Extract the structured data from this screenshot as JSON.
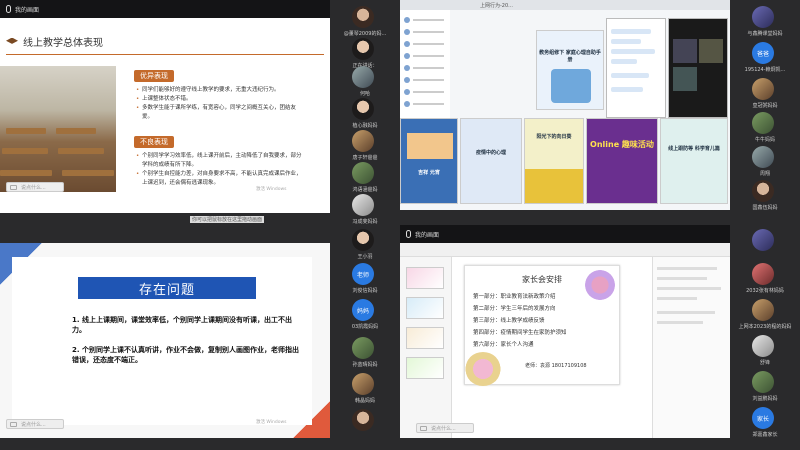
{
  "q1": {
    "top_label": "我的画面",
    "slide_title": "线上教学总体表现",
    "good_label": "优异表现",
    "good_items": [
      "同学们能够好的遵守线上教学的要求，无重大违纪行为。",
      "上课整体状态不错。",
      "多数学生能于课所学练，有宽容心，同学之间概互关心，团结友爱。"
    ],
    "bad_label": "不良表现",
    "bad_items": [
      "个别同学学习效率低，线上课开前后，主动降低了自我要求，部分学科的成绩有所下降。",
      "个别学生自控能力差，对自身要求不高，不能认真完成课后作业，上课迟到，还会偶有逃课现象。"
    ],
    "chat_placeholder": "说点什么...",
    "watermark": "激活 Windows",
    "bottom_overlay": "你可以把鼠标放在这里拖动画面",
    "participants": [
      {
        "name": "@董琴2009的妈...",
        "avatar": "photo1"
      },
      {
        "name": "正在讲话：",
        "avatar": "blue",
        "text": ""
      },
      {
        "name": "何哈",
        "avatar": "photo4"
      },
      {
        "name": "植心融妈妈",
        "avatar": "photo2"
      },
      {
        "name": "唐子轩爸爸",
        "avatar": "photo5"
      },
      {
        "name": "鸿语涵爸妈",
        "avatar": "photo3"
      },
      {
        "name": "冯成斐妈妈",
        "avatar": "photo7"
      }
    ]
  },
  "q2": {
    "top_label": "我的画面",
    "tab_label": "上网行为-20...",
    "poster_texts": [
      "教务组修下 家庭心理自助手册",
      "吉祥 元宵",
      "Online 趣味活动",
      "线上跟防等 科学育儿篇",
      "疫情中的心理",
      "阳光下的向日葵"
    ],
    "participants": [
      {
        "name": "与鑫腾课堂妈妈",
        "avatar": "photo6"
      },
      {
        "name": "195124-赖炯凯...",
        "avatar": "blue",
        "text": "爸爸"
      },
      {
        "name": "皇冠粥妈妈",
        "avatar": "photo5"
      },
      {
        "name": "牛牛妈妈",
        "avatar": "photo3"
      },
      {
        "name": "周翔",
        "avatar": "photo4"
      },
      {
        "name": "国鑫伍妈妈",
        "avatar": "photo1"
      },
      {
        "name": "",
        "avatar": "photo3"
      }
    ]
  },
  "q3": {
    "banner": "存在问题",
    "items": [
      "1. 线上上课期间，课堂效率低，个别同学上课期间没有听课，出工不出力。",
      "2. 个别同学上课不认真听讲，作业不会做，复制别人画图作业，老师指出错误，还态度不端正。"
    ],
    "chat_placeholder": "说点什么...",
    "watermark": "激活 Windows",
    "participants": [
      {
        "name": "王小羽",
        "avatar": "photo2"
      },
      {
        "name": "刘俊信妈妈",
        "avatar": "blue",
        "text": "老师"
      },
      {
        "name": "03凯霞妈妈",
        "avatar": "blue",
        "text": "妈妈"
      },
      {
        "name": "孙蓝晴妈妈",
        "avatar": "photo3"
      },
      {
        "name": "韩晶妈妈",
        "avatar": "photo5"
      },
      {
        "name": "",
        "avatar": "photo1"
      }
    ]
  },
  "q4": {
    "top_label": "我的画面",
    "page_title": "家长会安排",
    "lines": [
      "第一部分：职业教育法新政策介绍",
      "第二部分：学生三年后的发展方向",
      "第三部分：线上教学成绩反馈",
      "第四部分：疫情期间学生在家防护须知",
      "第六部分：家长个人沟通"
    ],
    "signature": "老师：袁源  18017109108",
    "chat_placeholder": "说点什么...",
    "participants": [
      {
        "name": "",
        "avatar": "photo6"
      },
      {
        "name": "2032张有林妈妈",
        "avatar": "photo8"
      },
      {
        "name": "上网本2023的程的妈妈",
        "avatar": "photo5"
      },
      {
        "name": "舒锋",
        "avatar": "photo7"
      },
      {
        "name": "刘益鹏妈妈",
        "avatar": "photo3"
      },
      {
        "name": "郑嘉鑫家长",
        "avatar": "blue",
        "text": "家长"
      }
    ]
  }
}
